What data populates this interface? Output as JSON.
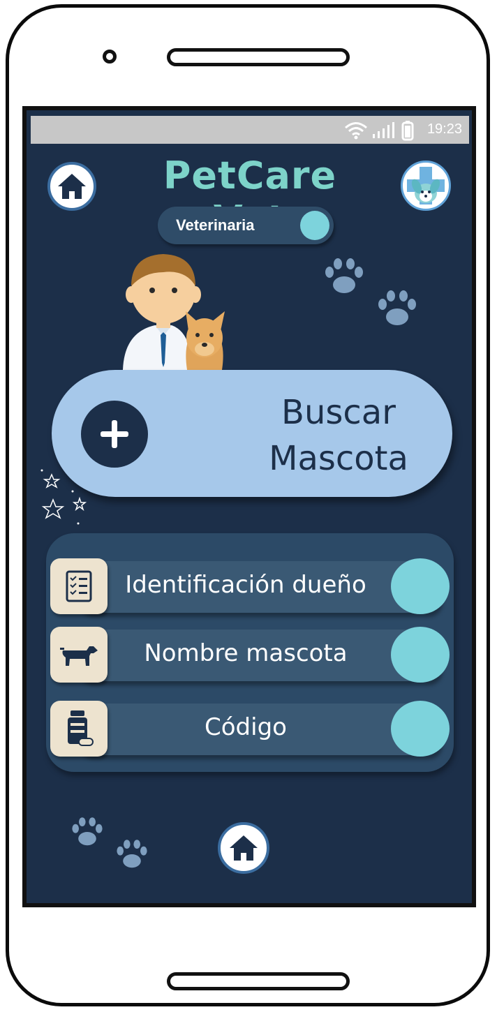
{
  "status_bar": {
    "time": "19:23"
  },
  "header": {
    "title": "PetCare Vet"
  },
  "mode_toggle": {
    "label": "Veterinaria"
  },
  "search": {
    "label_line1": "Buscar",
    "label_line2": "Mascota"
  },
  "options": [
    {
      "label": "Identificación dueño",
      "icon": "clipboard-checklist-icon"
    },
    {
      "label": "Nombre mascota",
      "icon": "dog-icon"
    },
    {
      "label": "Código",
      "icon": "medicine-bottle-icon"
    }
  ],
  "colors": {
    "screen_bg": "#1c2f49",
    "title": "#7dd3c9",
    "accent": "#7dd3dc",
    "search_button": "#a6c8ea",
    "icon_tile": "#ede3cf"
  }
}
